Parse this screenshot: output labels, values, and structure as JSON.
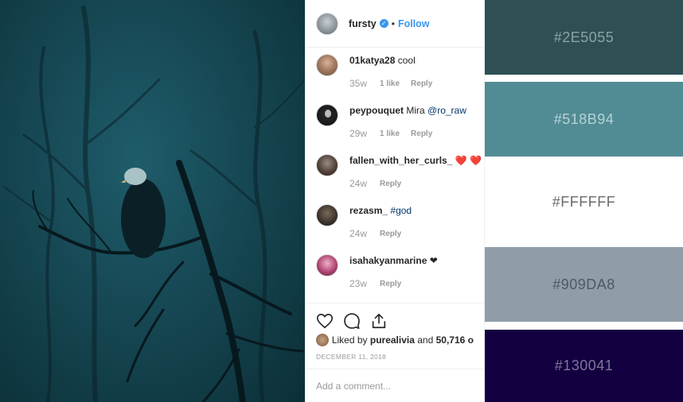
{
  "header": {
    "username": "fursty",
    "separator": "•",
    "follow_label": "Follow"
  },
  "comments": [
    {
      "user": "01katya28",
      "text": "cool",
      "mention": "",
      "time": "35w",
      "likes": "1 like",
      "reply": "Reply"
    },
    {
      "user": "peypouquet",
      "text": "Mira",
      "mention": "@ro_raw",
      "time": "29w",
      "likes": "1 like",
      "reply": "Reply"
    },
    {
      "user": "fallen_with_her_curls_",
      "text": "❤️ ❤️",
      "mention": "",
      "time": "24w",
      "likes": "",
      "reply": "Reply"
    },
    {
      "user": "rezasm_",
      "text": "",
      "mention": "#god",
      "time": "24w",
      "likes": "",
      "reply": "Reply"
    },
    {
      "user": "isahakyanmarine",
      "text": "❤",
      "mention": "",
      "time": "23w",
      "likes": "",
      "reply": "Reply"
    }
  ],
  "actions": {
    "liked_by_prefix": "Liked by",
    "liked_by_user": "purealivia",
    "liked_by_and": "and",
    "liked_by_count": "50,716 o",
    "date": "DECEMBER 11, 2018"
  },
  "add_comment": {
    "placeholder": "Add a comment..."
  },
  "palette": [
    {
      "hex": "#2E5055",
      "label": "#2E5055",
      "text_color": "#8aa3a6"
    },
    {
      "hex": "#518B94",
      "label": "#518B94",
      "text_color": "#b6d2d6"
    },
    {
      "hex": "#FFFFFF",
      "label": "#FFFFFF",
      "text_color": "#6b6b6b"
    },
    {
      "hex": "#909DA8",
      "label": "#909DA8",
      "text_color": "#4d5963"
    },
    {
      "hex": "#130041",
      "label": "#130041",
      "text_color": "#7d7698"
    }
  ],
  "icons": [
    "heart-icon",
    "comment-icon",
    "share-icon",
    "verified-badge-icon"
  ]
}
